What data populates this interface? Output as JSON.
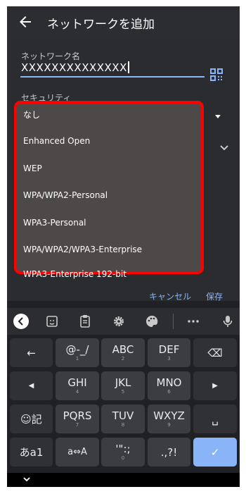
{
  "appbar": {
    "title": "ネットワークを追加"
  },
  "form": {
    "network_name_label": "ネットワーク名",
    "network_name_value": "XXXXXXXXXXXXXX",
    "security_label": "セキュリティ",
    "cancel_label": "キャンセル",
    "save_label": "保存"
  },
  "security_dropdown": {
    "highlight_color": "#ff0000",
    "options": [
      "なし",
      "Enhanced Open",
      "WEP",
      "WPA/WPA2-Personal",
      "WPA3-Personal",
      "WPA/WPA2/WPA3-Enterprise",
      "WPA3-Enterprise 192-bit"
    ]
  },
  "suggestion_bar": {
    "icons": [
      "back-arrow-icon",
      "sticker-icon",
      "clipboard-icon",
      "settings-gear-icon",
      "palette-icon",
      "more-icon",
      "mic-icon"
    ]
  },
  "keyboard": {
    "accent_color": "#8ab4f8",
    "rows": [
      [
        {
          "main": "←",
          "sub": ""
        },
        {
          "main": "@-_/",
          "sub": "1"
        },
        {
          "main": "ABC",
          "sub": "2"
        },
        {
          "main": "DEF",
          "sub": "3"
        },
        {
          "main": "⌫",
          "sub": ""
        }
      ],
      [
        {
          "main": "◀",
          "sub": ""
        },
        {
          "main": "GHI",
          "sub": "4"
        },
        {
          "main": "JKL",
          "sub": "5"
        },
        {
          "main": "MNO",
          "sub": "6"
        },
        {
          "main": "▶",
          "sub": ""
        }
      ],
      [
        {
          "main": "☺記",
          "sub": ""
        },
        {
          "main": "PQRS",
          "sub": "7"
        },
        {
          "main": "TUV",
          "sub": "8"
        },
        {
          "main": "WXYZ",
          "sub": "9"
        },
        {
          "main": "␣",
          "sub": ""
        }
      ],
      [
        {
          "main": "あa1",
          "sub": ""
        },
        {
          "main": "a⇔A",
          "sub": ""
        },
        {
          "main": "'\":;",
          "sub": "0"
        },
        {
          "main": ".,?!",
          "sub": ""
        },
        {
          "main": "✓",
          "sub": ""
        }
      ]
    ]
  },
  "navbar": {
    "icon": "chevron-down-icon"
  }
}
